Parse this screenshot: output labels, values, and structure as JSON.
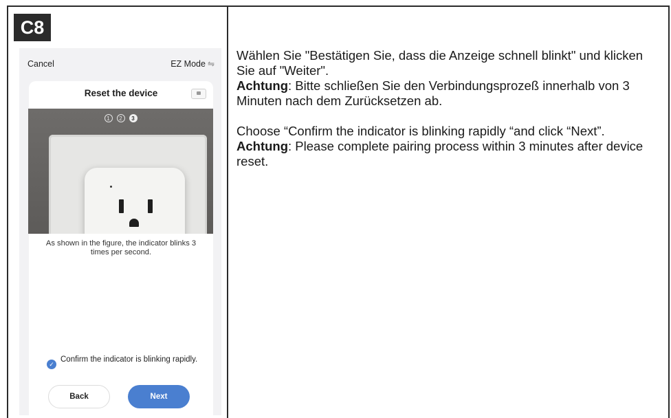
{
  "badge": "C8",
  "phone": {
    "cancel": "Cancel",
    "mode": "EZ Mode",
    "title": "Reset the device",
    "steps": [
      "1",
      "2",
      "3"
    ],
    "hint": "As shown in the figure, the indicator blinks 3 times per second.",
    "confirm": "Confirm the indicator is blinking rapidly.",
    "back": "Back",
    "next": "Next"
  },
  "text": {
    "de_line1": "Wählen Sie \"Bestätigen Sie, dass die Anzeige schnell blinkt\" und klicken Sie auf \"Weiter\".",
    "de_label": "Achtung",
    "de_line2": ": Bitte schließen Sie den Verbindungsprozeß innerhalb von 3 Minuten nach dem Zurücksetzen ab.",
    "en_line1": "Choose “Confirm the indicator is blinking rapidly “and click “Next”.",
    "en_label": "Achtung",
    "en_line2": ": Please complete pairing process within 3 minutes after device reset."
  }
}
